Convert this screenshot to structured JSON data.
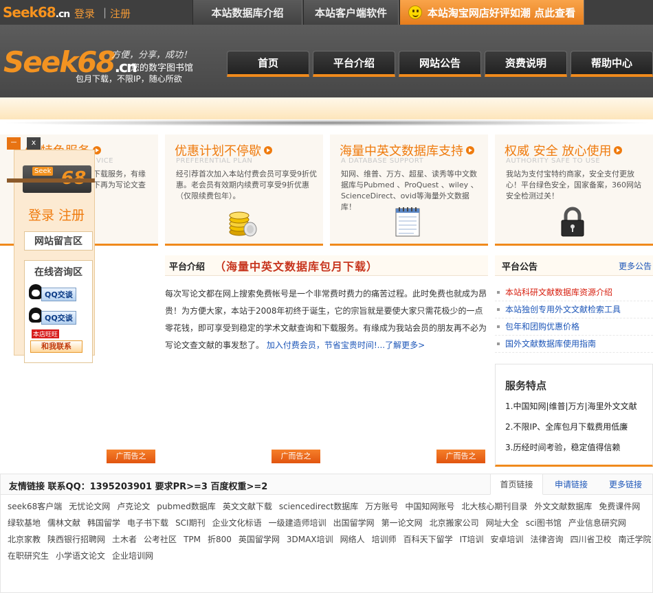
{
  "topbar": {
    "logo": "Seek68",
    "logo_suffix": ".cn",
    "login": "登录",
    "separator": "|",
    "register": "注册",
    "tabs": [
      "本站数据库介绍",
      "本站客户端软件"
    ],
    "promo": "本站淘宝网店好评如潮 点此查看"
  },
  "header": {
    "logo": "Seek68",
    "logo_suffix": ".cn",
    "slogan_italic": "方便，分享，成功！",
    "slogan_library": "您的数字图书馆",
    "slogan_sub": "包月下载，不限IP，随心所欲",
    "nav": [
      "首页",
      "平台介绍",
      "网站公告",
      "资费说明",
      "帮助中心"
    ]
  },
  "features": [
    {
      "title": "68特色服务",
      "sub": "VICE",
      "desc": "下载服务，有缘\n下再为写论文查"
    },
    {
      "title": "优惠计划不停歇",
      "sub": "PREFERENTIAL PLAN",
      "desc": "经引荐首次加入本站付费会员可享受9折优惠。老会员有效期内续费可享受9折优惠（仅限续费包年）。",
      "icon": "coins-icon"
    },
    {
      "title": "海量中英文数据库支持",
      "sub": "A DATABASE SUPPORT",
      "desc": "知网、维普、万方、超星、读秀等中文数据库与Pubmed 、ProQuest 、wiley 、ScienceDirect、ovid等海量外文数据库！",
      "icon": "notepad-icon"
    },
    {
      "title": "权威 安全 放心使用",
      "sub": "AUTHORITY SAFE TO USE",
      "desc": "我站为支付宝特约商家，安全支付更放心！平台绿色安全，国家备案，360网站安全检测过关！",
      "icon": "lock-icon"
    }
  ],
  "float_panel": {
    "minimize": "－",
    "close": "x",
    "logo_seek": "Seek",
    "logo_68": "68",
    "login_register": "登录 注册",
    "message_board": "网站留言区",
    "online_title": "在线咨询区",
    "qq_label": "QQ交谈",
    "shop_label": "本店旺旺",
    "contact_label": "和我联系"
  },
  "intro": {
    "title": "平台介绍",
    "slogan": "（海量中英文数据库包月下载）",
    "text": "每次写论文都在网上搜索免费帐号是一个非常费时费力的痛苦过程。此时免费也就成为昂贵！为方便大家，本站于2008年初终于诞生，它的宗旨就是要使大家只需花极少的一点零花钱，即可享受到稳定的学术文献查询和下载服务。有缘成为我站会员的朋友再不必为写论文查文献的事发愁了。",
    "link": "加入付费会员，节省宝贵时间!...了解更多>"
  },
  "notice": {
    "title": "平台公告",
    "more": "更多公告",
    "items": [
      "本站科研文献数据库资源介绍",
      "本站独创专用外文文献检索工具",
      "包年和团购优惠价格",
      "国外文献数据库使用指南"
    ]
  },
  "service": {
    "title": "服务特点",
    "items": [
      "1.中国知网|维普|万方|海里外文文献",
      "2.不限IP、全库包月下载费用低廉",
      "3.历经时间考验，稳定值得信赖"
    ]
  },
  "ads": [
    "广而告之",
    "广而告之",
    "广而告之"
  ],
  "links": {
    "title": "友情链接  联系QQ：1395203901  要求PR>=3 百度权重>=2",
    "tabs": [
      "首页链接",
      "申请链接",
      "更多链接"
    ],
    "rows": [
      [
        "seek68客户端",
        "无忧论文网",
        "卢克论文",
        "pubmed数据库",
        "英文文献下载",
        "sciencedirect数据库",
        "万方账号",
        "中国知网账号",
        "北大核心期刊目录",
        "外文文献数据库",
        "免费课件网"
      ],
      [
        "绿软基地",
        "儒林文献",
        "韩国留学",
        "电子书下载",
        "SCI期刊",
        "企业文化标语",
        "一级建造师培训",
        "出国留学网",
        "第一论文网",
        "北京搬家公司",
        "网址大全",
        "sci图书馆",
        "产业信息研究网"
      ],
      [
        "北京家教",
        "陕西银行招聘网",
        "土木者",
        "公考社区",
        "TPM",
        "折800",
        "英国留学网",
        "3DMAX培训",
        "网络人",
        "培训师",
        "百科天下留学",
        "IT培训",
        "安卓培训",
        "法律咨询",
        "四川省卫校",
        "南迁学院"
      ],
      [
        "在职研究生",
        "小学语文论文",
        "企业培训网"
      ]
    ]
  }
}
